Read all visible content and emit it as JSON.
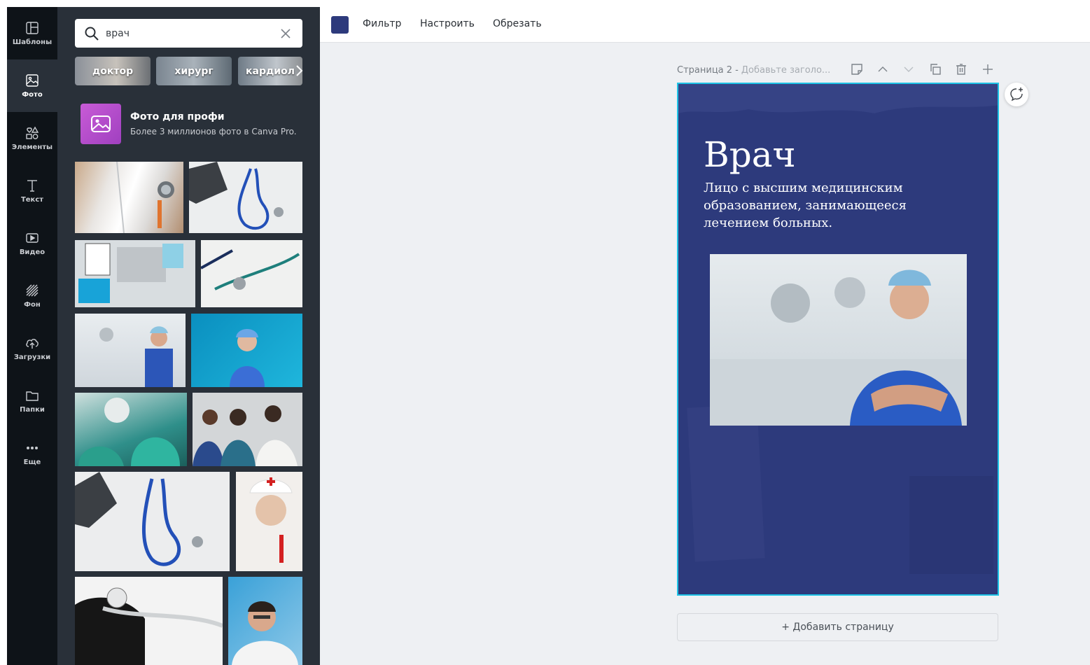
{
  "rail": {
    "items": [
      {
        "label": "Шаблоны",
        "icon": "layout-icon"
      },
      {
        "label": "Фото",
        "icon": "image-icon"
      },
      {
        "label": "Элементы",
        "icon": "shapes-icon"
      },
      {
        "label": "Текст",
        "icon": "text-icon"
      },
      {
        "label": "Видео",
        "icon": "video-icon"
      },
      {
        "label": "Фон",
        "icon": "background-icon"
      },
      {
        "label": "Загрузки",
        "icon": "upload-icon"
      },
      {
        "label": "Папки",
        "icon": "folder-icon"
      },
      {
        "label": "Еще",
        "icon": "more-icon"
      }
    ],
    "active": "Фото"
  },
  "panel": {
    "search_value": "врач",
    "chips": [
      "доктор",
      "хирург",
      "кардиол"
    ],
    "promo": {
      "title": "Фото для профи",
      "subtitle": "Более 3 миллионов фото в Canva Pro."
    }
  },
  "toolbar": {
    "color": "#2d3a7c",
    "filter_label": "Фильтр",
    "adjust_label": "Настроить",
    "crop_label": "Обрезать"
  },
  "page": {
    "label": "Страница 2 -",
    "title_placeholder": "Добавьте заголо..."
  },
  "design": {
    "title": "Врач",
    "subtitle": "Лицо с высшим медицинским образованием, занимающееся лечением больных.",
    "background": "#2d3a7c"
  },
  "add_page_label": "+ Добавить страницу",
  "colors": {
    "selection": "#1ec3e6",
    "panel_bg": "#293039",
    "rail_bg": "#0e1318"
  }
}
